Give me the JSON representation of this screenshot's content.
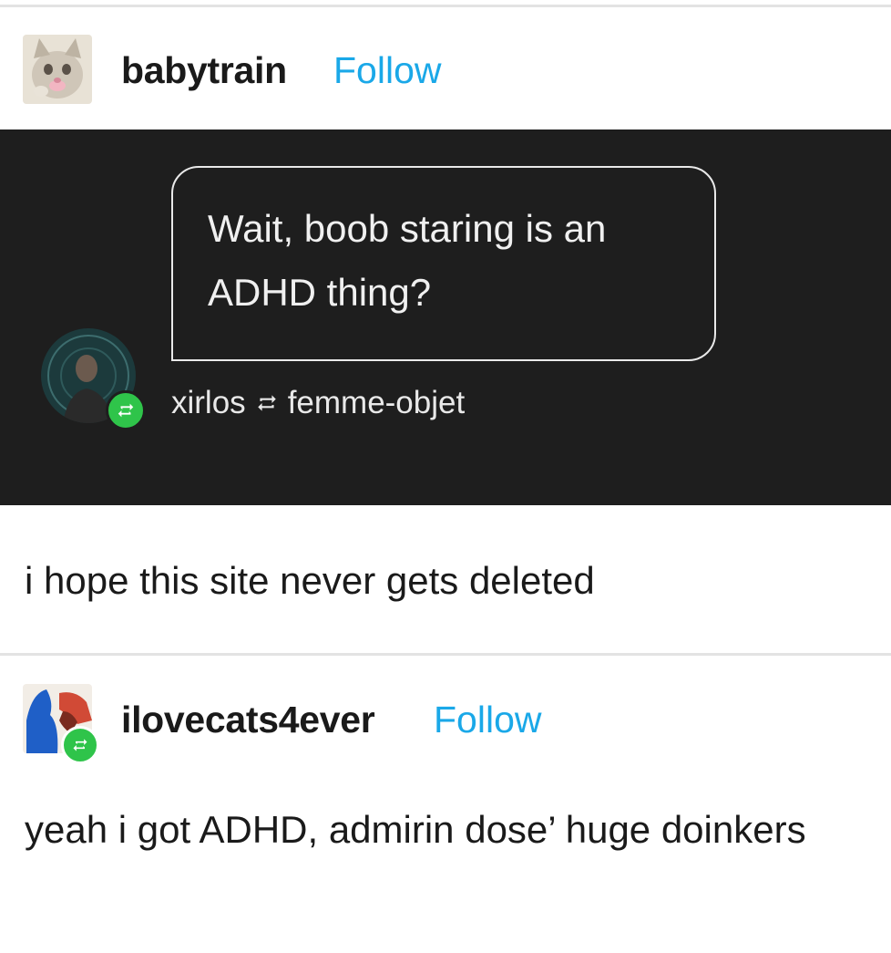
{
  "post1": {
    "username": "babytrain",
    "follow_label": "Follow",
    "avatar_icon": "kitten-avatar",
    "screenshot": {
      "message": "Wait, boob staring is an ADHD thing?",
      "reblog_from": "xirlos",
      "reblog_via_icon": "reblog-icon",
      "reblog_to": "femme-objet"
    },
    "comment": "i hope this site never gets deleted"
  },
  "post2": {
    "username": "ilovecats4ever",
    "follow_label": "Follow",
    "avatar_icon": "abstract-avatar",
    "reply": "yeah i got ADHD, admirin dose’ huge doinkers"
  },
  "colors": {
    "follow": "#1aa8e8",
    "reblog_badge": "#2fc44a",
    "dark_panel": "#1e1e1e"
  }
}
